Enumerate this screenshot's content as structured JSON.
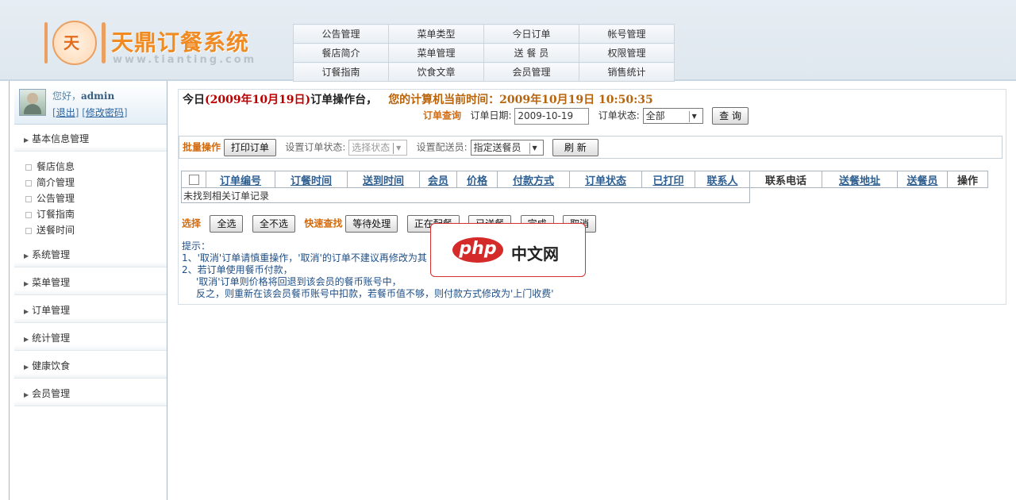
{
  "header": {
    "logo_char": "天",
    "logo_title": "天鼎订餐系统",
    "logo_url": "www.tianting.com",
    "nav": [
      [
        "公告管理",
        "菜单类型",
        "今日订单",
        "帐号管理"
      ],
      [
        "餐店简介",
        "菜单管理",
        "送 餐 员",
        "权限管理"
      ],
      [
        "订餐指南",
        "饮食文章",
        "会员管理",
        "销售统计"
      ]
    ]
  },
  "sidebar": {
    "greeting": "您好，",
    "username": "admin",
    "logout": "退出",
    "change_password": "修改密码",
    "menus": [
      {
        "label": "基本信息管理",
        "items": [
          "餐店信息",
          "简介管理",
          "公告管理",
          "订餐指南",
          "送餐时间"
        ]
      },
      {
        "label": "系统管理"
      },
      {
        "label": "菜单管理"
      },
      {
        "label": "订单管理"
      },
      {
        "label": "统计管理"
      },
      {
        "label": "健康饮食"
      },
      {
        "label": "会员管理"
      }
    ]
  },
  "main": {
    "title_prefix": "今日",
    "title_date": "(2009年10月19日)",
    "title_suffix": "订单操作台，",
    "current_time_label": "您的计算机当前时间：2009年10月19日 10:50:35",
    "query": {
      "heading": "订单查询",
      "date_label": "订单日期:",
      "date_value": "2009-10-19",
      "status_label": "订单状态:",
      "status_value": "全部",
      "search_button": "查 询"
    },
    "batch": {
      "heading": "批量操作",
      "print_button": "打印订单",
      "set_status_label": "设置订单状态:",
      "set_status_value": "选择状态",
      "set_courier_label": "设置配送员:",
      "set_courier_value": "指定送餐员",
      "refresh_button": "刷 新"
    },
    "table": {
      "columns": [
        "订单编号",
        "订餐时间",
        "送到时间",
        "会员",
        "价格",
        "付款方式",
        "订单状态",
        "已打印",
        "联系人",
        "联系电话",
        "送餐地址",
        "送餐员",
        "操作"
      ],
      "empty_text": "未找到相关订单记录"
    },
    "quick": {
      "select_label": "选择",
      "select_all": "全选",
      "select_none": "全不选",
      "quick_find_label": "快速查找",
      "buttons": [
        "等待处理",
        "正在配餐",
        "已送餐",
        "完成",
        "取消"
      ]
    },
    "tips": {
      "heading": "提示：",
      "line1": "1、'取消'订单请慎重操作，'取消'的订单不建议再修改为其",
      "line2": "2、若订单使用餐币付款，",
      "line3": "'取消'订单则价格将回退到该会员的餐币账号中，",
      "line4": "反之，则重新在该会员餐币账号中扣款，若餐币值不够，则付款方式修改为'上门收费'"
    }
  },
  "overlay": {
    "brand": "php",
    "text": "中文网"
  }
}
